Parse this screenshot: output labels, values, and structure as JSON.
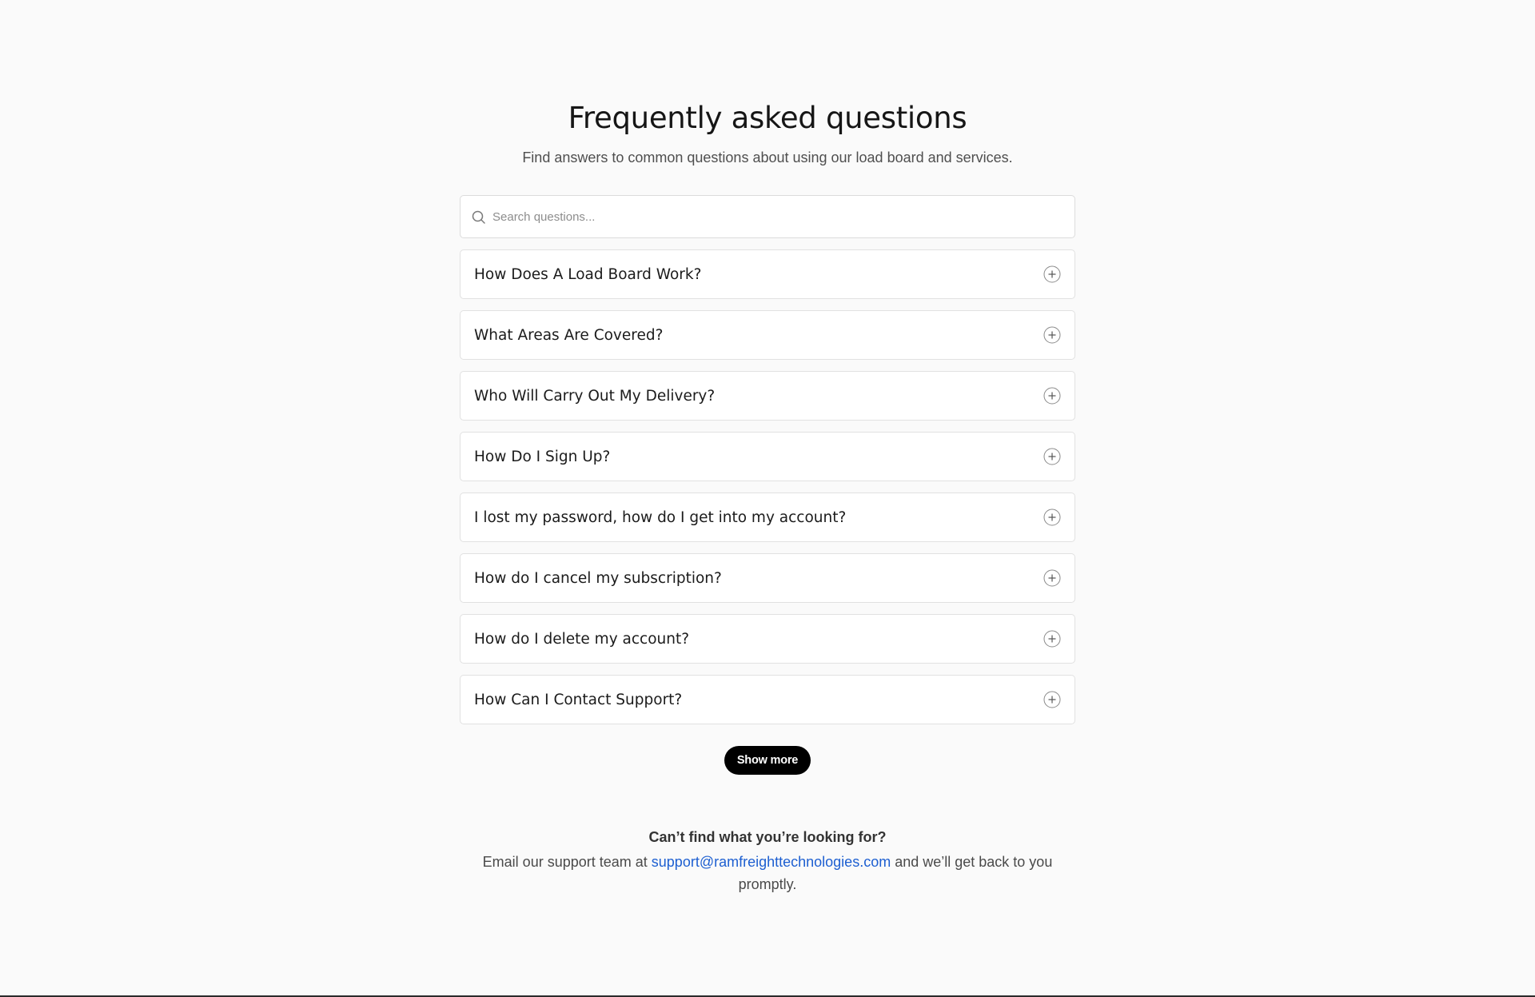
{
  "header": {
    "title": "Frequently asked questions",
    "subtitle": "Find answers to common questions about using our load board and services."
  },
  "search": {
    "placeholder": "Search questions...",
    "value": "",
    "icon": "search-icon"
  },
  "faq": {
    "items": [
      {
        "question": "How Does A Load Board Work?",
        "icon": "plus-icon"
      },
      {
        "question": "What Areas Are Covered?",
        "icon": "plus-icon"
      },
      {
        "question": "Who Will Carry Out My Delivery?",
        "icon": "plus-icon"
      },
      {
        "question": "How Do I Sign Up?",
        "icon": "plus-icon"
      },
      {
        "question": "I lost my password, how do I get into my account?",
        "icon": "plus-icon"
      },
      {
        "question": "How do I cancel my subscription?",
        "icon": "plus-icon"
      },
      {
        "question": "How do I delete my account?",
        "icon": "plus-icon"
      },
      {
        "question": "How Can I Contact Support?",
        "icon": "plus-icon"
      }
    ],
    "show_more_label": "Show more"
  },
  "contact": {
    "heading": "Can’t find what you’re looking for?",
    "text_before": "Email our support team at ",
    "email": "support@ramfreighttechnologies.com",
    "text_after": " and we’ll get back to you promptly."
  },
  "colors": {
    "background": "#fafafa",
    "link": "#1d5fd1",
    "button": "#000000"
  }
}
